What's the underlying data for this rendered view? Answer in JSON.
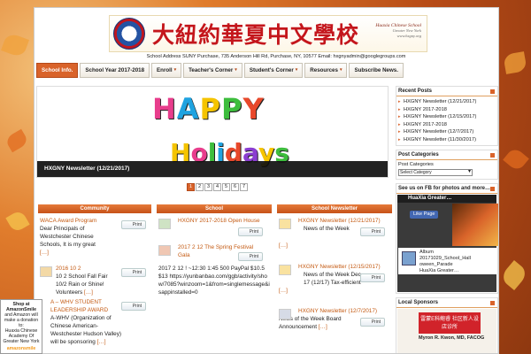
{
  "header": {
    "cn_title": "大紐約華夏中文學校",
    "en_name": "Huaxia Chinese School",
    "en_sub1": "Greater New York",
    "en_sub2": "www.hxgny.org",
    "address": "School Address SUNY Purchase, 735 Anderson Hill Rd, Purchase, NY, 10577     Email: hxgnyadmin@googlegroups.com"
  },
  "nav": {
    "items": [
      {
        "label": "School Info."
      },
      {
        "label": "School Year 2017-2018"
      },
      {
        "label": "Enroll"
      },
      {
        "label": "Teacher's Corner"
      },
      {
        "label": "Student's Corner"
      },
      {
        "label": "Resources"
      },
      {
        "label": "Subscribe News."
      }
    ]
  },
  "slider": {
    "image_text_1": "HAPPY",
    "image_text_2": "Holidays",
    "caption": "HXGNY Newsletter (12/21/2017)",
    "pages": [
      "1",
      "2",
      "3",
      "4",
      "5",
      "6",
      "7"
    ],
    "active_page": "1"
  },
  "community": {
    "heading": "Community",
    "posts": [
      {
        "title": "WACA Award Program",
        "excerpt": "Dear Principals of Westchester Chinese Schools, It is my great",
        "more": "[…]"
      },
      {
        "title": "2016 10 2",
        "excerpt": "10 2        School Fall Fair 10/2  Rain or Shine! Volunteers",
        "more": "[…]"
      },
      {
        "title": "A – WHV STUDENT LEADERSHIP AWARD",
        "excerpt": "A-WHV (Organization of Chinese American-Westchester Hudson Valley) will be sponsoring",
        "more": "[…]"
      }
    ]
  },
  "school": {
    "heading": "School",
    "posts": [
      {
        "title": "HXGNY 2017-2018 Open House",
        "excerpt": ""
      },
      {
        "title": "2017 2 12          The Spring Festival Gala",
        "excerpt": "2017 2 12       !       ~12:30     1:45      500   PayPal  $10.5    $13     https://yunbanbao.com/ggb/activity/show/7085?winzoom=1&from=singlemessage&isappinstalled=0"
      }
    ]
  },
  "newsletter": {
    "heading": "School Newsletter",
    "posts": [
      {
        "title": "HXGNY Newsletter (12/21/2017)",
        "excerpt": "News of the Week",
        "more": "[…]"
      },
      {
        "title": "HXGNY Newsletter (12/15/2017)",
        "excerpt": "News of the Week Dec 17      (12/17)  Tax-efficient",
        "more": "[…]"
      },
      {
        "title": "HXGNY Newsletter (12/7/2017)",
        "excerpt": "News of the Week    Board Announcement",
        "more": "[…]"
      }
    ]
  },
  "print_label": "Print",
  "sidebar": {
    "recent_heading": "Recent Posts",
    "recent": [
      "HXGNY Newsletter (12/21/2017)",
      "HXGNY               2017-2018",
      "HXGNY Newsletter (12/15/2017)",
      "HXGNY               2017-2018",
      "HXGNY Newsletter (12/7/2017)",
      "HXGNY Newsletter (11/30/2017)"
    ],
    "cat_heading": "Post Categories",
    "cat_label": "Post Categories",
    "cat_select": "Select Category",
    "fb_heading": "See us on FB for photos and more…",
    "fb_page": "HuaXia Greater…",
    "fb_like": "Like Page",
    "fb_album_1": "Album",
    "fb_album_2": "20171029_School_Hall",
    "fb_album_3": "oween_Parade",
    "fb_album_4": "HuaXia Greater…",
    "sponsor_heading": "Local Sponsors",
    "sponsor_text": "雷蒙E科鲍睿 社区新人设店诊所",
    "sponsor_name": "Myron R. Kwon, MD, FACOG"
  },
  "amazon": {
    "line1": "Shop at AmazonSmile",
    "line2": "and Amazon will make a donation to:",
    "line3": "Huaxia Chinese Academy Of Greater New York",
    "logo_a": "amazon",
    "logo_b": "smile"
  },
  "colors": {
    "accent": "#d9632a",
    "link": "#c45a12",
    "brand_red": "#c4161c"
  }
}
